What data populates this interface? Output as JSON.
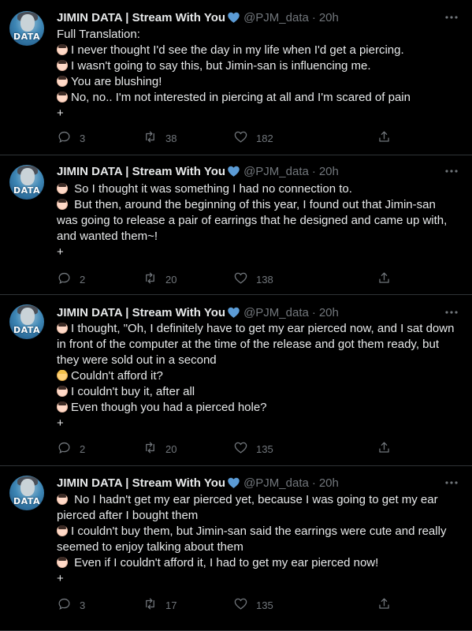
{
  "tweets": [
    {
      "author_name": "JIMIN DATA | Stream With You",
      "handle": "@PJM_data",
      "separator": "·",
      "time": "20h",
      "avatar_text": "DATA",
      "lines": [
        {
          "text": "Full Translation:",
          "icon": ""
        },
        {
          "text": "I never thought I'd see the day in my life when I'd get a piercing.",
          "icon": "person-emoji"
        },
        {
          "text": "I wasn't going to say this, but Jimin-san is influencing me.",
          "icon": "person-emoji"
        },
        {
          "text": "You are blushing!",
          "icon": "person-emoji"
        },
        {
          "text": "No, no.. I'm not interested in piercing at all and I'm scared of pain",
          "icon": "person-emoji"
        },
        {
          "text": "+",
          "icon": ""
        }
      ],
      "replies": "3",
      "retweets": "38",
      "likes": "182"
    },
    {
      "author_name": "JIMIN DATA | Stream With You",
      "handle": "@PJM_data",
      "separator": "·",
      "time": "20h",
      "avatar_text": "DATA",
      "lines": [
        {
          "text": " So I thought it was something I had no connection to.",
          "icon": "person-emoji"
        },
        {
          "text": " But then, around the beginning of this year, I found out that Jimin-san was going to release a pair of earrings that he designed and came up with, and wanted them~!",
          "icon": "person-emoji"
        },
        {
          "text": "+",
          "icon": ""
        }
      ],
      "replies": "2",
      "retweets": "20",
      "likes": "138"
    },
    {
      "author_name": "JIMIN DATA | Stream With You",
      "handle": "@PJM_data",
      "separator": "·",
      "time": "20h",
      "avatar_text": "DATA",
      "lines": [
        {
          "text": "I thought, \"Oh, I definitely have to get my ear pierced now, and I sat down in front of the computer at the time of the release and got them ready, but they were sold out in a second",
          "icon": "person-emoji"
        },
        {
          "text": "Couldn't afford it?",
          "icon": "blonde-person-emoji"
        },
        {
          "text": "I couldn't buy it, after all",
          "icon": "person-emoji"
        },
        {
          "text": "Even though you had a pierced hole?",
          "icon": "person-emoji"
        },
        {
          "text": "+",
          "icon": ""
        }
      ],
      "replies": "2",
      "retweets": "20",
      "likes": "135"
    },
    {
      "author_name": "JIMIN DATA | Stream With You",
      "handle": "@PJM_data",
      "separator": "·",
      "time": "20h",
      "avatar_text": "DATA",
      "lines": [
        {
          "text": " No I hadn't get my ear pierced yet, because I was going to get my ear pierced after I bought them",
          "icon": "person-emoji"
        },
        {
          "text": "I couldn't buy them, but Jimin-san said the earrings were cute and really seemed to enjoy talking about them",
          "icon": "person-emoji"
        },
        {
          "text": " Even if I couldn't afford it, I had to get my ear pierced now!",
          "icon": "person-emoji"
        },
        {
          "text": "+",
          "icon": ""
        }
      ],
      "replies": "3",
      "retweets": "17",
      "likes": "135"
    }
  ],
  "colors": {
    "background": "#000000",
    "text": "#e7e9ea",
    "muted": "#71767b",
    "verified_badge": "#5b9bd5",
    "divider": "#2f3336"
  }
}
